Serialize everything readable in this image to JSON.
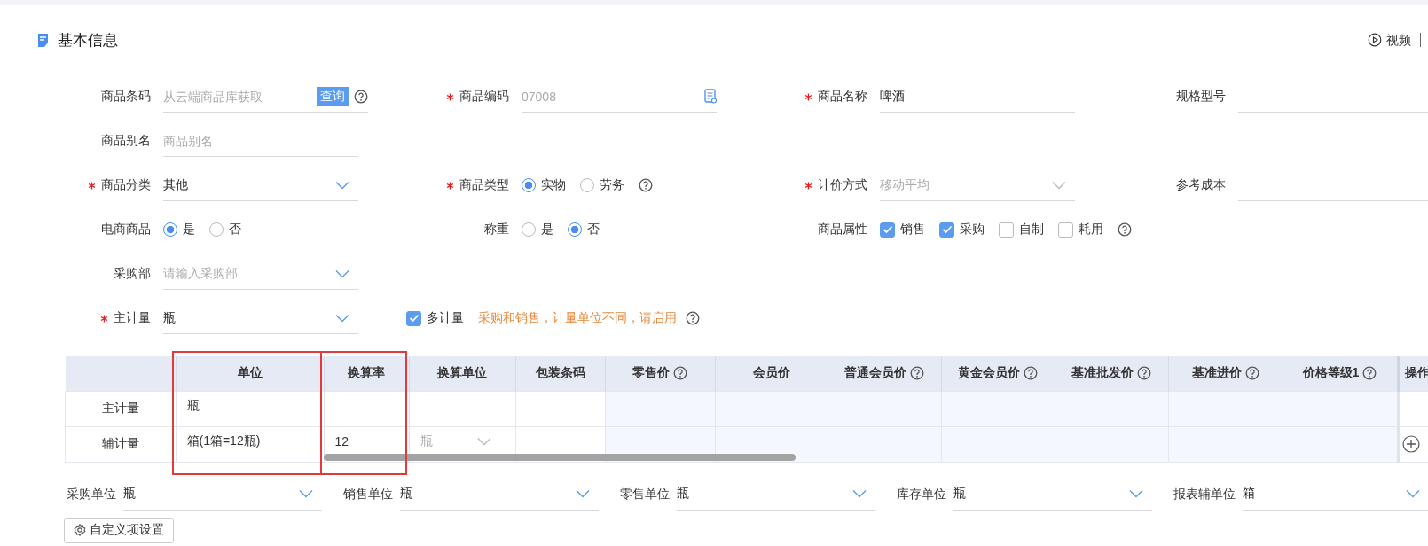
{
  "section": {
    "title": "基本信息",
    "video_link": "视频"
  },
  "form_rows": [
    [
      {
        "kind": "text",
        "label": "商品条码",
        "required": false,
        "placeholder": "从云端商品库获取",
        "button": "查询",
        "help": true
      },
      {
        "kind": "text",
        "label": "商品编码",
        "required": true,
        "placeholder": "07008",
        "action_icon": true
      },
      {
        "kind": "text",
        "label": "商品名称",
        "required": true,
        "value": "啤酒"
      },
      {
        "kind": "text",
        "label": "规格型号",
        "required": false
      }
    ],
    [
      {
        "kind": "text",
        "label": "商品别名",
        "required": false,
        "placeholder": "商品别名"
      }
    ],
    [
      {
        "kind": "select",
        "label": "商品分类",
        "required": true,
        "value": "其他"
      },
      {
        "kind": "radio",
        "label": "商品类型",
        "required": true,
        "help": true,
        "options": [
          {
            "label": "实物",
            "selected": true
          },
          {
            "label": "劳务",
            "selected": false
          }
        ]
      },
      {
        "kind": "select",
        "label": "计价方式",
        "required": true,
        "placeholder": "移动平均",
        "disabled": true
      },
      {
        "kind": "text",
        "label": "参考成本",
        "required": false
      }
    ],
    [
      {
        "kind": "radio",
        "label": "电商商品",
        "required": false,
        "options": [
          {
            "label": "是",
            "selected": true
          },
          {
            "label": "否",
            "selected": false
          }
        ]
      },
      {
        "kind": "radio",
        "label": "称重",
        "required": false,
        "options": [
          {
            "label": "是",
            "selected": false
          },
          {
            "label": "否",
            "selected": true
          }
        ]
      },
      {
        "kind": "checkbox",
        "label": "商品属性",
        "help": true,
        "options": [
          {
            "label": "销售",
            "checked": true
          },
          {
            "label": "采购",
            "checked": true
          },
          {
            "label": "自制",
            "checked": false
          },
          {
            "label": "耗用",
            "checked": false
          }
        ]
      }
    ],
    [
      {
        "kind": "select",
        "label": "采购部",
        "required": false,
        "placeholder": "请输入采购部"
      }
    ],
    [
      {
        "kind": "select",
        "label": "主计量",
        "required": true,
        "value": "瓶"
      },
      {
        "kind": "multi_unit",
        "label": "多计量",
        "checked": true,
        "hint": "采购和销售，计量单位不同，请启用",
        "help": true
      }
    ]
  ],
  "table": {
    "columns": [
      {
        "kind": "text",
        "label": "单位",
        "highlighted": true
      },
      {
        "kind": "text",
        "label": "换算率",
        "highlighted": true
      },
      {
        "kind": "select",
        "label": "换算单位"
      },
      {
        "kind": "text",
        "label": "包装条码"
      },
      {
        "kind": "price",
        "label": "零售价",
        "help": true
      },
      {
        "kind": "price",
        "label": "会员价"
      },
      {
        "kind": "price",
        "label": "普通会员价",
        "help": true
      },
      {
        "kind": "price",
        "label": "黄金会员价",
        "help": true
      },
      {
        "kind": "price",
        "label": "基准批发价",
        "help": true
      },
      {
        "kind": "price",
        "label": "基准进价",
        "help": true
      },
      {
        "kind": "price",
        "label": "价格等级1",
        "help": true
      },
      {
        "kind": "actions",
        "label": "操作"
      }
    ],
    "rows": [
      {
        "label": "主计量",
        "unit": "瓶"
      },
      {
        "label": "辅计量",
        "unit": "箱(1箱=12瓶)",
        "rate": "12",
        "conv_unit": "瓶",
        "add": true
      }
    ]
  },
  "unit_selects": [
    {
      "label": "采购单位",
      "value": "瓶"
    },
    {
      "label": "销售单位",
      "value": "瓶"
    },
    {
      "label": "零售单位",
      "value": "瓶"
    },
    {
      "label": "库存单位",
      "value": "瓶"
    },
    {
      "label": "报表辅单位",
      "value": "箱"
    }
  ],
  "custom_button": "自定义项设置"
}
